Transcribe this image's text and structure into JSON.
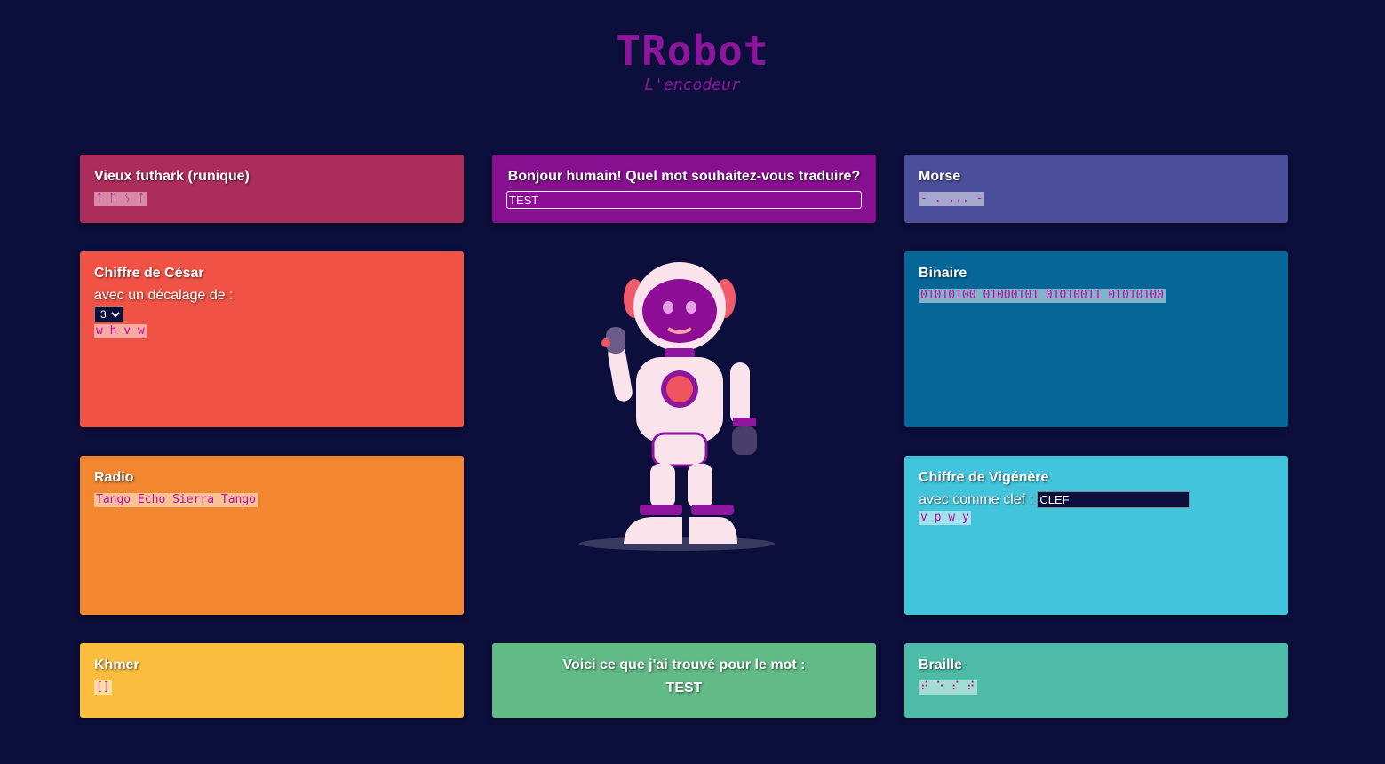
{
  "header": {
    "title": "TRobot",
    "subtitle": "L'encodeur"
  },
  "input_card": {
    "prompt": "Bonjour humain! Quel mot souhaitez-vous traduire?",
    "value": "TEST"
  },
  "futhark": {
    "title": "Vieux futhark (runique)",
    "result": "ᛏ ᛖ ᛊ ᛏ"
  },
  "morse": {
    "title": "Morse",
    "result": "- . ... -"
  },
  "cesar": {
    "title": "Chiffre de César",
    "label": "avec un décalage de :",
    "shift": "3",
    "result": "w h v w"
  },
  "binaire": {
    "title": "Binaire",
    "result": "01010100 01000101 01010011 01010100"
  },
  "radio": {
    "title": "Radio",
    "result": "Tango Echo Sierra Tango"
  },
  "vigenere": {
    "title": "Chiffre de Vigénère",
    "label": "avec comme clef :",
    "key": "CLEF",
    "result": "v p w y"
  },
  "khmer": {
    "title": "Khmer",
    "result": "[]"
  },
  "found": {
    "label": "Voici ce que j'ai trouvé pour le mot :",
    "word": "TEST"
  },
  "braille": {
    "title": "Braille",
    "result": "⠞ ⠑ ⠎ ⠞"
  },
  "colors": {
    "background": "#0c0f3b",
    "futhark": "#ad2d5a",
    "input": "#86108f",
    "morse": "#4a4e9b",
    "cesar": "#f05245",
    "binaire": "#066698",
    "radio": "#f2872f",
    "vigenere": "#42c4dc",
    "khmer": "#fbbd3d",
    "found": "#62bb87",
    "braille": "#4dbba7",
    "result_text": "#b5109f"
  }
}
